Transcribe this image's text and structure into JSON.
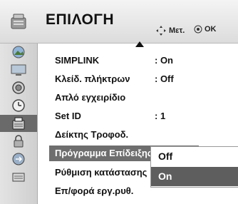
{
  "header": {
    "title": "ΕΠΙΛΟΓΗ",
    "move_hint": "Μετ.",
    "ok_hint": "OK"
  },
  "sidebar": {
    "items": [
      {
        "icon": "picture-icon"
      },
      {
        "icon": "tv-icon"
      },
      {
        "icon": "speaker-icon"
      },
      {
        "icon": "clock-icon"
      },
      {
        "icon": "option-icon",
        "active": true
      },
      {
        "icon": "lock-icon"
      },
      {
        "icon": "input-icon"
      },
      {
        "icon": "usb-icon"
      }
    ]
  },
  "menu": {
    "items": [
      {
        "label": "SIMPLINK",
        "value": ": On"
      },
      {
        "label": "Κλείδ. πλήκτρων",
        "value": ": Off"
      },
      {
        "label": "Απλό εγχειρίδιο",
        "value": ""
      },
      {
        "label": "Set ID",
        "value": ": 1"
      },
      {
        "label": "Δείκτης Τροφοδ.",
        "value": ""
      },
      {
        "label": "Πρόγραμμα Επίδειξης",
        "value": ""
      },
      {
        "label": "Ρύθμιση κατάστασης",
        "value": ""
      },
      {
        "label": "Επ/φορά εργ.ρυθ.",
        "value": ""
      }
    ],
    "selected_index": 5
  },
  "popup": {
    "options": [
      "Off",
      "On"
    ],
    "highlighted": "On"
  }
}
